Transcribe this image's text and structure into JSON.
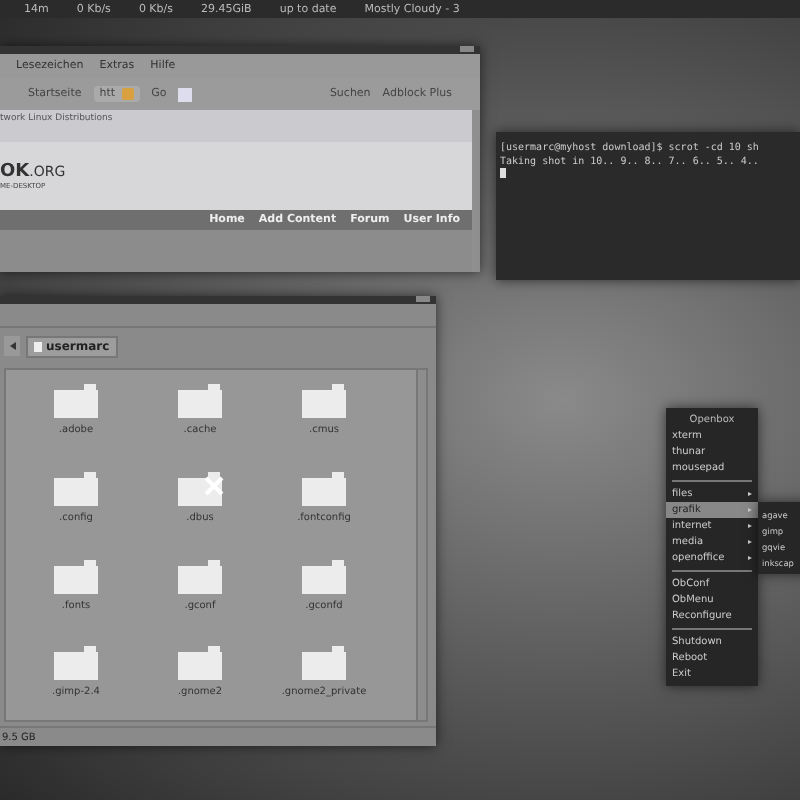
{
  "top_panel": {
    "items": [
      "14m",
      "0 Kb/s",
      "0 Kb/s",
      "29.45GiB",
      "up to date",
      "Mostly Cloudy - 3"
    ]
  },
  "browser": {
    "menu": [
      "Lesezeichen",
      "Extras",
      "Hilfe"
    ],
    "toolbar": {
      "home": "Startseite",
      "url": "htt",
      "go": "Go",
      "search": "Suchen",
      "adblock": "Adblock Plus"
    },
    "page": {
      "breadcrumb": "twork  Linux Distributions",
      "logo": "OK",
      "logo_suffix": ".ORG",
      "logo_tagline": "ME-DESKTOP",
      "nav": [
        "Home",
        "Add Content",
        "Forum",
        "User Info"
      ]
    }
  },
  "terminal": {
    "lines": [
      "[usermarc@myhost download]$ scrot -cd 10 sh",
      "Taking shot in 10.. 9.. 8.. 7.. 6.. 5.. 4.."
    ]
  },
  "file_manager": {
    "path": "usermarc",
    "folders": [
      ".adobe",
      ".cache",
      ".cmus",
      ".config",
      ".dbus",
      ".fontconfig",
      ".fonts",
      ".gconf",
      ".gconfd",
      ".gimp-2.4",
      ".gnome2",
      ".gnome2_private"
    ],
    "status": "9.5 GB"
  },
  "openbox_menu": {
    "items": [
      {
        "kind": "header",
        "label": "Openbox"
      },
      {
        "kind": "item",
        "label": "xterm",
        "selected": false
      },
      {
        "kind": "item",
        "label": "thunar",
        "selected": false
      },
      {
        "kind": "item",
        "label": "mousepad",
        "selected": false
      },
      {
        "kind": "separator"
      },
      {
        "kind": "submenu",
        "label": "files",
        "selected": false
      },
      {
        "kind": "submenu",
        "label": "grafik",
        "selected": true
      },
      {
        "kind": "submenu",
        "label": "internet",
        "selected": false
      },
      {
        "kind": "submenu",
        "label": "media",
        "selected": false
      },
      {
        "kind": "submenu",
        "label": "openoffice",
        "selected": false
      },
      {
        "kind": "separator"
      },
      {
        "kind": "item",
        "label": "ObConf",
        "selected": false
      },
      {
        "kind": "item",
        "label": "ObMenu",
        "selected": false
      },
      {
        "kind": "item",
        "label": "Reconfigure",
        "selected": false
      },
      {
        "kind": "separator"
      },
      {
        "kind": "item",
        "label": "Shutdown",
        "selected": false
      },
      {
        "kind": "item",
        "label": "Reboot",
        "selected": false
      },
      {
        "kind": "item",
        "label": "Exit",
        "selected": false
      }
    ],
    "submenu": [
      "agave",
      "gimp",
      "gqvie",
      "inkscap"
    ]
  }
}
